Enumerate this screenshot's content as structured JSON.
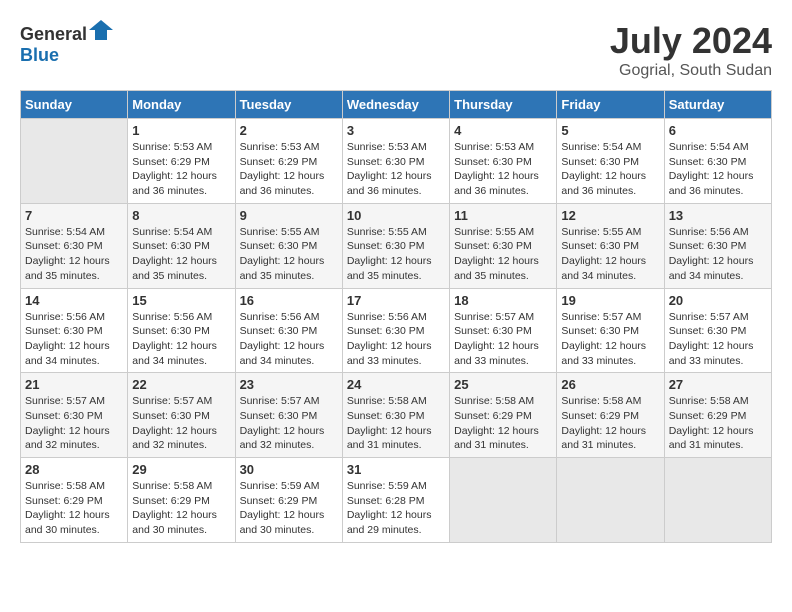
{
  "header": {
    "logo_general": "General",
    "logo_blue": "Blue",
    "title": "July 2024",
    "subtitle": "Gogrial, South Sudan"
  },
  "calendar": {
    "days_of_week": [
      "Sunday",
      "Monday",
      "Tuesday",
      "Wednesday",
      "Thursday",
      "Friday",
      "Saturday"
    ],
    "weeks": [
      [
        {
          "day": "",
          "info": ""
        },
        {
          "day": "1",
          "info": "Sunrise: 5:53 AM\nSunset: 6:29 PM\nDaylight: 12 hours\nand 36 minutes."
        },
        {
          "day": "2",
          "info": "Sunrise: 5:53 AM\nSunset: 6:29 PM\nDaylight: 12 hours\nand 36 minutes."
        },
        {
          "day": "3",
          "info": "Sunrise: 5:53 AM\nSunset: 6:30 PM\nDaylight: 12 hours\nand 36 minutes."
        },
        {
          "day": "4",
          "info": "Sunrise: 5:53 AM\nSunset: 6:30 PM\nDaylight: 12 hours\nand 36 minutes."
        },
        {
          "day": "5",
          "info": "Sunrise: 5:54 AM\nSunset: 6:30 PM\nDaylight: 12 hours\nand 36 minutes."
        },
        {
          "day": "6",
          "info": "Sunrise: 5:54 AM\nSunset: 6:30 PM\nDaylight: 12 hours\nand 36 minutes."
        }
      ],
      [
        {
          "day": "7",
          "info": "Sunrise: 5:54 AM\nSunset: 6:30 PM\nDaylight: 12 hours\nand 35 minutes."
        },
        {
          "day": "8",
          "info": "Sunrise: 5:54 AM\nSunset: 6:30 PM\nDaylight: 12 hours\nand 35 minutes."
        },
        {
          "day": "9",
          "info": "Sunrise: 5:55 AM\nSunset: 6:30 PM\nDaylight: 12 hours\nand 35 minutes."
        },
        {
          "day": "10",
          "info": "Sunrise: 5:55 AM\nSunset: 6:30 PM\nDaylight: 12 hours\nand 35 minutes."
        },
        {
          "day": "11",
          "info": "Sunrise: 5:55 AM\nSunset: 6:30 PM\nDaylight: 12 hours\nand 35 minutes."
        },
        {
          "day": "12",
          "info": "Sunrise: 5:55 AM\nSunset: 6:30 PM\nDaylight: 12 hours\nand 34 minutes."
        },
        {
          "day": "13",
          "info": "Sunrise: 5:56 AM\nSunset: 6:30 PM\nDaylight: 12 hours\nand 34 minutes."
        }
      ],
      [
        {
          "day": "14",
          "info": "Sunrise: 5:56 AM\nSunset: 6:30 PM\nDaylight: 12 hours\nand 34 minutes."
        },
        {
          "day": "15",
          "info": "Sunrise: 5:56 AM\nSunset: 6:30 PM\nDaylight: 12 hours\nand 34 minutes."
        },
        {
          "day": "16",
          "info": "Sunrise: 5:56 AM\nSunset: 6:30 PM\nDaylight: 12 hours\nand 34 minutes."
        },
        {
          "day": "17",
          "info": "Sunrise: 5:56 AM\nSunset: 6:30 PM\nDaylight: 12 hours\nand 33 minutes."
        },
        {
          "day": "18",
          "info": "Sunrise: 5:57 AM\nSunset: 6:30 PM\nDaylight: 12 hours\nand 33 minutes."
        },
        {
          "day": "19",
          "info": "Sunrise: 5:57 AM\nSunset: 6:30 PM\nDaylight: 12 hours\nand 33 minutes."
        },
        {
          "day": "20",
          "info": "Sunrise: 5:57 AM\nSunset: 6:30 PM\nDaylight: 12 hours\nand 33 minutes."
        }
      ],
      [
        {
          "day": "21",
          "info": "Sunrise: 5:57 AM\nSunset: 6:30 PM\nDaylight: 12 hours\nand 32 minutes."
        },
        {
          "day": "22",
          "info": "Sunrise: 5:57 AM\nSunset: 6:30 PM\nDaylight: 12 hours\nand 32 minutes."
        },
        {
          "day": "23",
          "info": "Sunrise: 5:57 AM\nSunset: 6:30 PM\nDaylight: 12 hours\nand 32 minutes."
        },
        {
          "day": "24",
          "info": "Sunrise: 5:58 AM\nSunset: 6:30 PM\nDaylight: 12 hours\nand 31 minutes."
        },
        {
          "day": "25",
          "info": "Sunrise: 5:58 AM\nSunset: 6:29 PM\nDaylight: 12 hours\nand 31 minutes."
        },
        {
          "day": "26",
          "info": "Sunrise: 5:58 AM\nSunset: 6:29 PM\nDaylight: 12 hours\nand 31 minutes."
        },
        {
          "day": "27",
          "info": "Sunrise: 5:58 AM\nSunset: 6:29 PM\nDaylight: 12 hours\nand 31 minutes."
        }
      ],
      [
        {
          "day": "28",
          "info": "Sunrise: 5:58 AM\nSunset: 6:29 PM\nDaylight: 12 hours\nand 30 minutes."
        },
        {
          "day": "29",
          "info": "Sunrise: 5:58 AM\nSunset: 6:29 PM\nDaylight: 12 hours\nand 30 minutes."
        },
        {
          "day": "30",
          "info": "Sunrise: 5:59 AM\nSunset: 6:29 PM\nDaylight: 12 hours\nand 30 minutes."
        },
        {
          "day": "31",
          "info": "Sunrise: 5:59 AM\nSunset: 6:28 PM\nDaylight: 12 hours\nand 29 minutes."
        },
        {
          "day": "",
          "info": ""
        },
        {
          "day": "",
          "info": ""
        },
        {
          "day": "",
          "info": ""
        }
      ]
    ]
  }
}
